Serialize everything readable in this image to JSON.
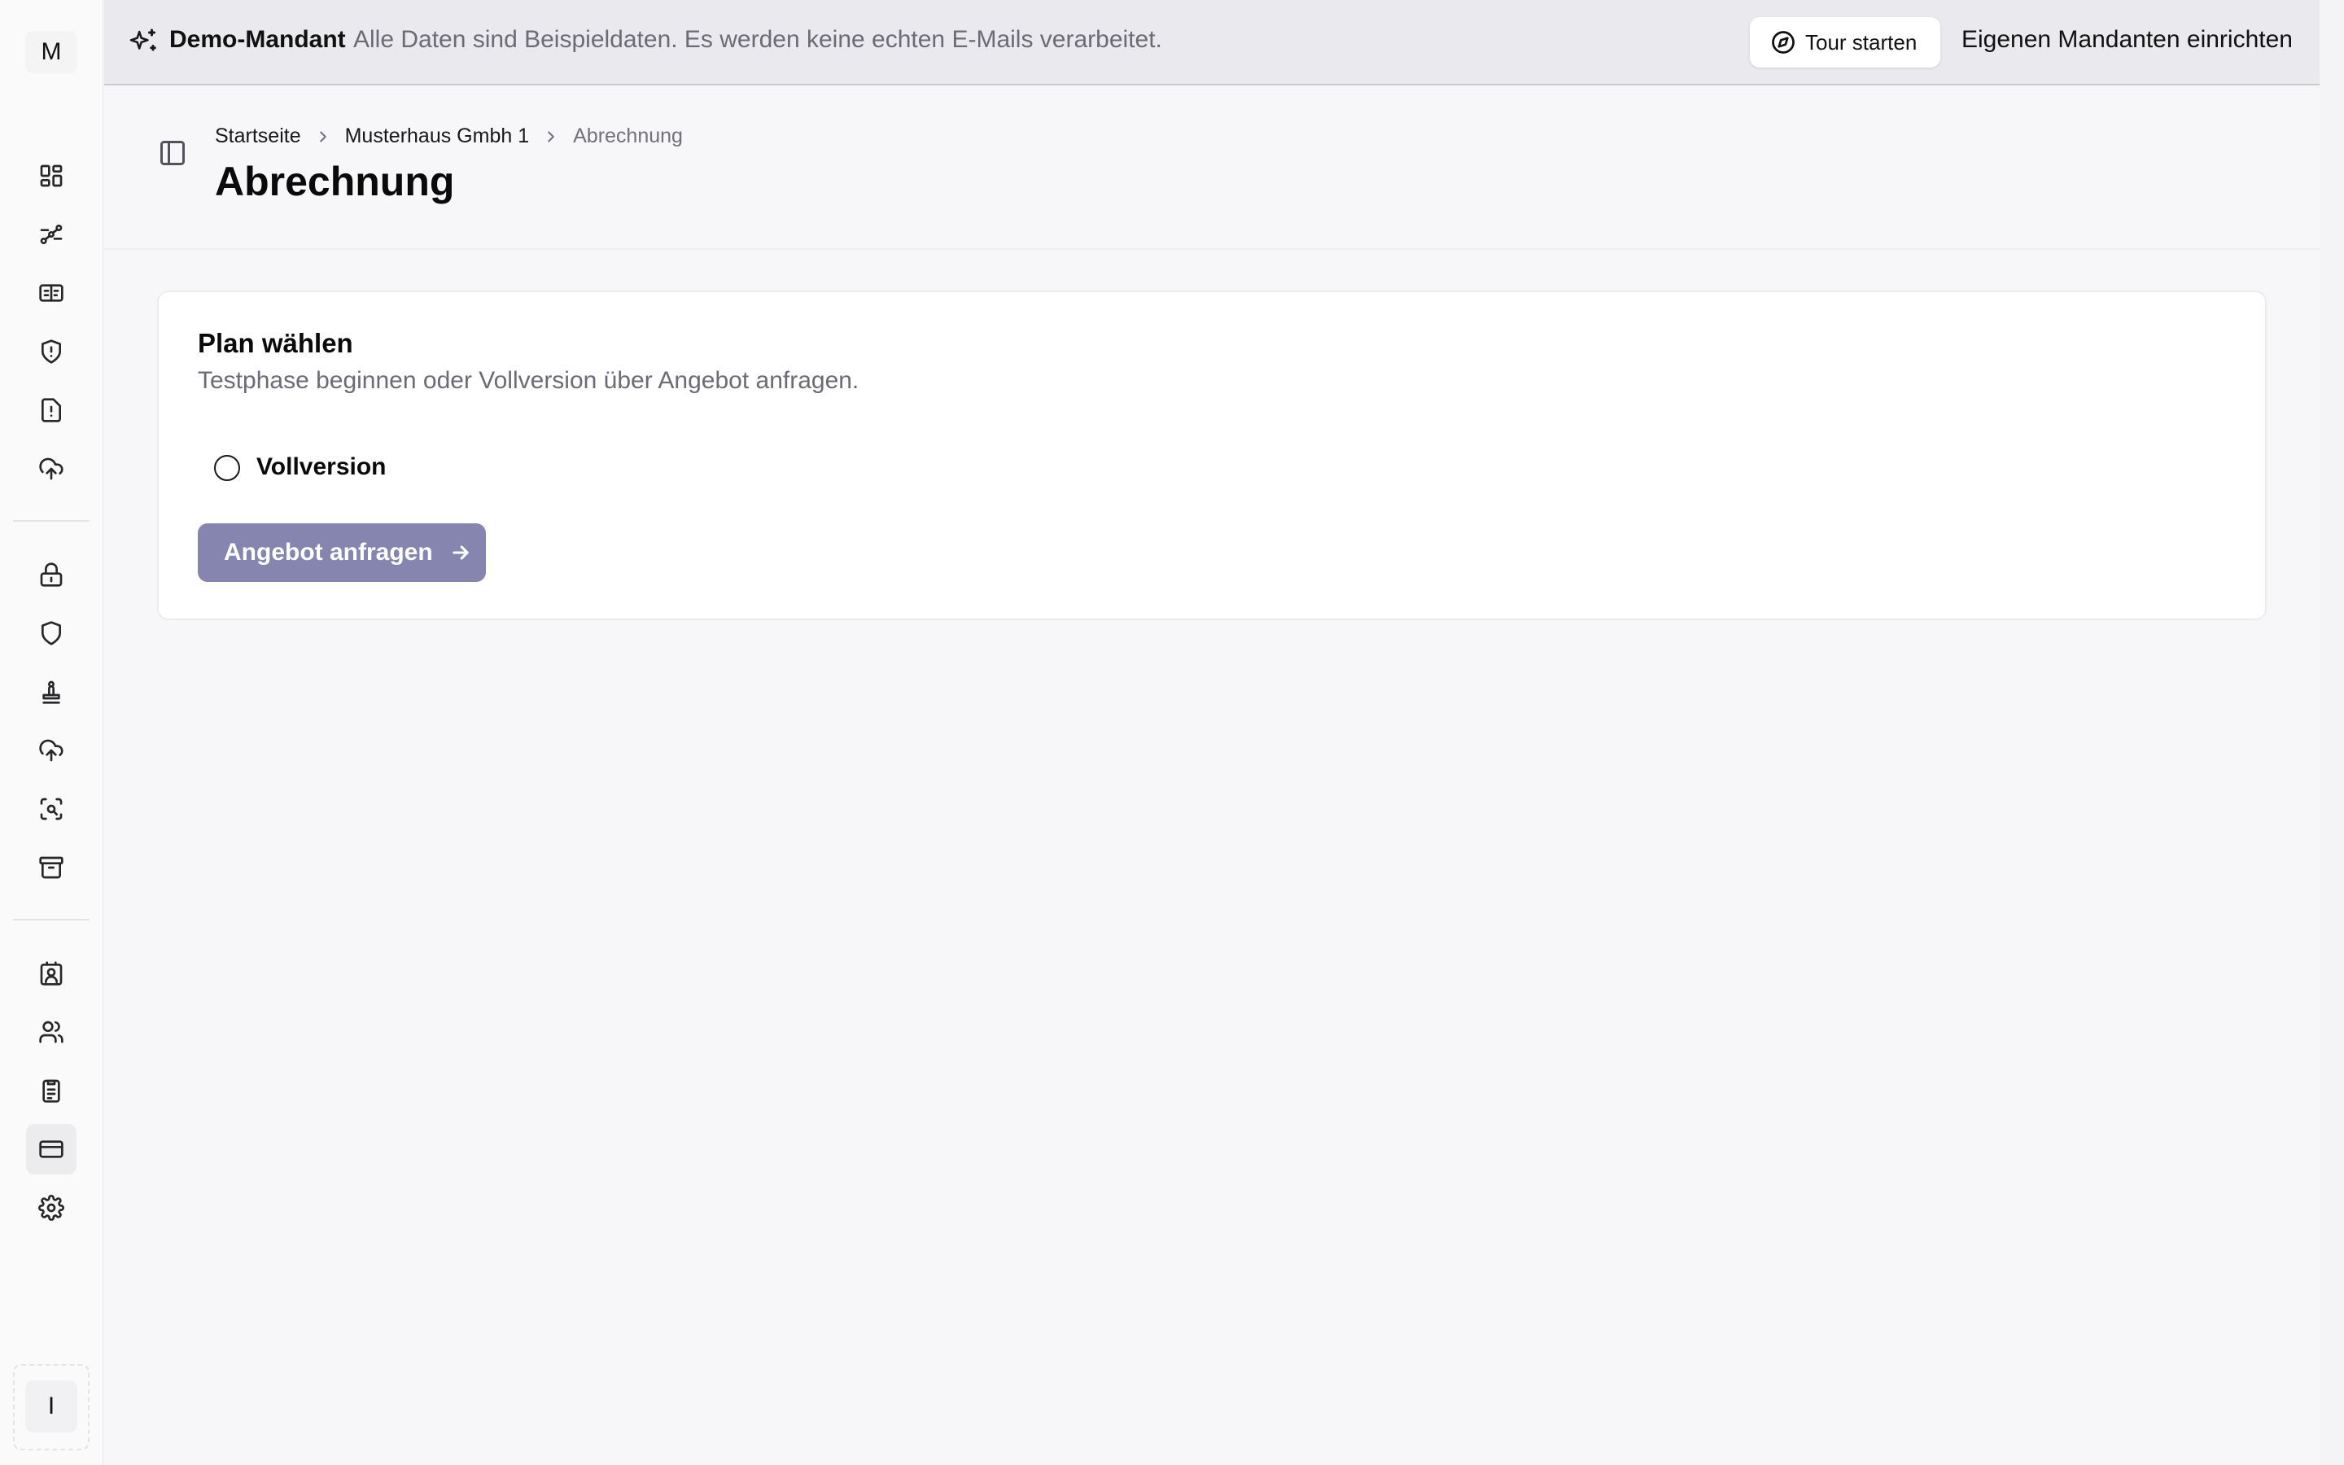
{
  "sidebar": {
    "logo_letter": "M",
    "user_initial": "I",
    "icons": [
      "dashboard-icon",
      "workflow-icon",
      "id-card-icon",
      "shield-alert-icon",
      "file-alert-icon",
      "cloud-upload-icon",
      "lock-icon",
      "shield-icon",
      "stamp-icon",
      "cloud-upload-icon",
      "scan-search-icon",
      "archive-icon",
      "contact-icon",
      "users-icon",
      "clipboard-list-icon",
      "credit-card-icon",
      "settings-icon"
    ],
    "active_icon": "credit-card-icon"
  },
  "banner": {
    "title": "Demo-Mandant",
    "note": "Alle Daten sind Beispieldaten. Es werden keine echten E-Mails verarbeitet.",
    "tour_button": "Tour starten",
    "own_tenant_link": "Eigenen Mandanten einrichten"
  },
  "breadcrumb": {
    "home": "Startseite",
    "company": "Musterhaus Gmbh 1",
    "current": "Abrechnung"
  },
  "page": {
    "title": "Abrechnung"
  },
  "plan_card": {
    "title": "Plan wählen",
    "subtitle": "Testphase beginnen oder Vollversion über Angebot anfragen.",
    "option_label": "Vollversion",
    "option_selected": false,
    "button_label": "Angebot anfragen"
  },
  "colors": {
    "primary_button": "#8585b0",
    "banner_bg": "#eaeaee",
    "page_bg": "#f7f7f9"
  }
}
